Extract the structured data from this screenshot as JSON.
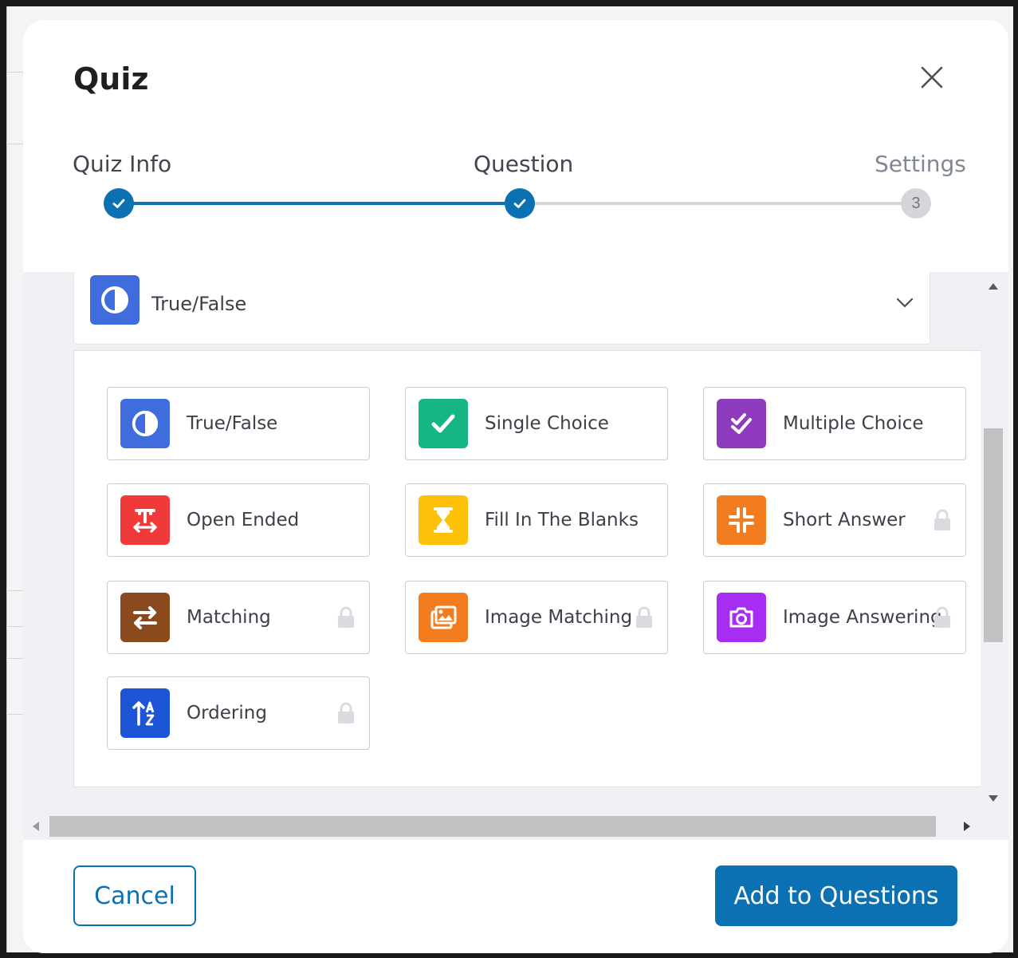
{
  "modal": {
    "title": "Quiz"
  },
  "steps": [
    {
      "label": "Quiz Info",
      "status": "complete"
    },
    {
      "label": "Question",
      "status": "complete"
    },
    {
      "label": "Settings",
      "status": "pending",
      "number": "3"
    }
  ],
  "question_type_select": {
    "selected_label": "True/False",
    "selected_icon": "contrast-icon",
    "expanded": true
  },
  "question_types": [
    {
      "label": "True/False",
      "icon": "contrast-icon",
      "color": "#3f6ddd",
      "locked": false
    },
    {
      "label": "Single Choice",
      "icon": "check-icon",
      "color": "#16b585",
      "locked": false
    },
    {
      "label": "Multiple Choice",
      "icon": "double-check-icon",
      "color": "#8e3bbd",
      "locked": false
    },
    {
      "label": "Open Ended",
      "icon": "text-resize-icon",
      "color": "#f03a3a",
      "locked": false
    },
    {
      "label": "Fill In The Blanks",
      "icon": "hourglass-icon",
      "color": "#fec008",
      "locked": false
    },
    {
      "label": "Short Answer",
      "icon": "compress-icon",
      "color": "#f37c1e",
      "locked": true
    },
    {
      "label": "Matching",
      "icon": "swap-arrows-icon",
      "color": "#8b4a1d",
      "locked": true
    },
    {
      "label": "Image Matching",
      "icon": "images-icon",
      "color": "#f37c1e",
      "locked": true
    },
    {
      "label": "Image Answering",
      "icon": "camera-icon",
      "color": "#a82df2",
      "locked": true
    },
    {
      "label": "Ordering",
      "icon": "sort-az-icon",
      "color": "#1c55d6",
      "locked": true
    }
  ],
  "footer": {
    "cancel_label": "Cancel",
    "submit_label": "Add to Questions"
  },
  "colors": {
    "primary": "#0c71b2",
    "pending": "#d4d6db"
  }
}
